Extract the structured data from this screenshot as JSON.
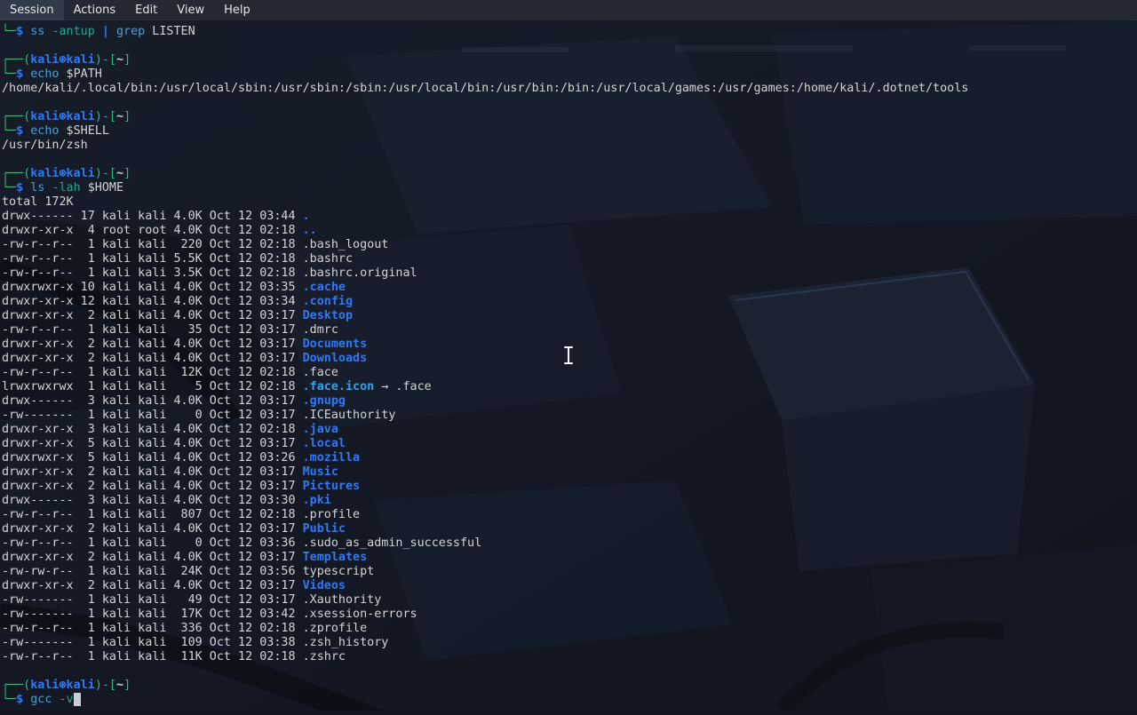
{
  "menubar": {
    "items": [
      {
        "label": "Session"
      },
      {
        "label": "Actions"
      },
      {
        "label": "Edit"
      },
      {
        "label": "View"
      },
      {
        "label": "Help"
      }
    ]
  },
  "prompt": {
    "user_host": "kali㉿kali",
    "cwd": "~"
  },
  "colors": {
    "menu_bg": "#232833",
    "menu_fg": "#e3e5e8",
    "term_bg": "#131824",
    "green": "#38b873",
    "blue": "#3179f2",
    "command": "#4f9fd0",
    "option": "#2aa595",
    "symlink": "#34a4e9",
    "fg": "#d2d4d6",
    "cursor": "#c9ced6"
  },
  "commands": {
    "history": [
      "ss -antup | grep LISTEN",
      "echo $PATH",
      "echo $SHELL",
      "ls -lah $HOME"
    ],
    "current_input": "gcc -v"
  },
  "outputs": {
    "path": "/home/kali/.local/bin:/usr/local/sbin:/usr/sbin:/sbin:/usr/local/bin:/usr/bin:/bin:/usr/local/games:/usr/games:/home/kali/.dotnet/tools",
    "shell": "/usr/bin/zsh",
    "ls_total": "total 172K"
  },
  "terminal": {
    "lines": [
      [
        [
          "g",
          "└─"
        ],
        [
          "b",
          "$"
        ],
        [
          "w",
          " "
        ],
        [
          "c",
          "ss"
        ],
        [
          "w",
          " "
        ],
        [
          "o",
          "-antup"
        ],
        [
          "w",
          " "
        ],
        [
          "b",
          "|"
        ],
        [
          "w",
          " "
        ],
        [
          "c",
          "grep"
        ],
        [
          "w",
          " LISTEN"
        ]
      ],
      [],
      [
        [
          "g",
          "┌──("
        ],
        [
          "b",
          "kali⊛kali"
        ],
        [
          "g",
          ")-["
        ],
        [
          "wb",
          "~"
        ],
        [
          "g",
          "]"
        ]
      ],
      [
        [
          "g",
          "└─"
        ],
        [
          "b",
          "$"
        ],
        [
          "w",
          " "
        ],
        [
          "c",
          "echo"
        ],
        [
          "w",
          " $PATH"
        ]
      ],
      [
        [
          "w",
          "/home/kali/.local/bin:/usr/local/sbin:/usr/sbin:/sbin:/usr/local/bin:/usr/bin:/bin:/usr/local/games:/usr/games:/home/kali/.dotnet/tools"
        ]
      ],
      [],
      [
        [
          "g",
          "┌──("
        ],
        [
          "b",
          "kali⊛kali"
        ],
        [
          "g",
          ")-["
        ],
        [
          "wb",
          "~"
        ],
        [
          "g",
          "]"
        ]
      ],
      [
        [
          "g",
          "└─"
        ],
        [
          "b",
          "$"
        ],
        [
          "w",
          " "
        ],
        [
          "c",
          "echo"
        ],
        [
          "w",
          " $SHELL"
        ]
      ],
      [
        [
          "w",
          "/usr/bin/zsh"
        ]
      ],
      [],
      [
        [
          "g",
          "┌──("
        ],
        [
          "b",
          "kali⊛kali"
        ],
        [
          "g",
          ")-["
        ],
        [
          "wb",
          "~"
        ],
        [
          "g",
          "]"
        ]
      ],
      [
        [
          "g",
          "└─"
        ],
        [
          "b",
          "$"
        ],
        [
          "w",
          " "
        ],
        [
          "c",
          "ls"
        ],
        [
          "w",
          " "
        ],
        [
          "o",
          "-lah"
        ],
        [
          "w",
          " $HOME"
        ]
      ],
      [
        [
          "w",
          "total 172K"
        ]
      ],
      [
        [
          "w",
          "drwx------ 17 kali kali 4.0K Oct 12 03:44 "
        ],
        [
          "d",
          "."
        ]
      ],
      [
        [
          "w",
          "drwxr-xr-x  4 root root 4.0K Oct 12 02:18 "
        ],
        [
          "d",
          ".."
        ]
      ],
      [
        [
          "w",
          "-rw-r--r--  1 kali kali  220 Oct 12 02:18 .bash_logout"
        ]
      ],
      [
        [
          "w",
          "-rw-r--r--  1 kali kali 5.5K Oct 12 02:18 .bashrc"
        ]
      ],
      [
        [
          "w",
          "-rw-r--r--  1 kali kali 3.5K Oct 12 02:18 .bashrc.original"
        ]
      ],
      [
        [
          "w",
          "drwxrwxr-x 10 kali kali 4.0K Oct 12 03:35 "
        ],
        [
          "d",
          ".cache"
        ]
      ],
      [
        [
          "w",
          "drwxr-xr-x 12 kali kali 4.0K Oct 12 03:34 "
        ],
        [
          "d",
          ".config"
        ]
      ],
      [
        [
          "w",
          "drwxr-xr-x  2 kali kali 4.0K Oct 12 03:17 "
        ],
        [
          "d",
          "Desktop"
        ]
      ],
      [
        [
          "w",
          "-rw-r--r--  1 kali kali   35 Oct 12 03:17 .dmrc"
        ]
      ],
      [
        [
          "w",
          "drwxr-xr-x  2 kali kali 4.0K Oct 12 03:17 "
        ],
        [
          "d",
          "Documents"
        ]
      ],
      [
        [
          "w",
          "drwxr-xr-x  2 kali kali 4.0K Oct 12 03:17 "
        ],
        [
          "d",
          "Downloads"
        ]
      ],
      [
        [
          "w",
          "-rw-r--r--  1 kali kali  12K Oct 12 02:18 .face"
        ]
      ],
      [
        [
          "w",
          "lrwxrwxrwx  1 kali kali    5 Oct 12 02:18 "
        ],
        [
          "s",
          ".face.icon"
        ],
        [
          "w",
          " → .face"
        ]
      ],
      [
        [
          "w",
          "drwx------  3 kali kali 4.0K Oct 12 03:17 "
        ],
        [
          "d",
          ".gnupg"
        ]
      ],
      [
        [
          "w",
          "-rw-------  1 kali kali    0 Oct 12 03:17 .ICEauthority"
        ]
      ],
      [
        [
          "w",
          "drwxr-xr-x  3 kali kali 4.0K Oct 12 02:18 "
        ],
        [
          "d",
          ".java"
        ]
      ],
      [
        [
          "w",
          "drwxr-xr-x  5 kali kali 4.0K Oct 12 03:17 "
        ],
        [
          "d",
          ".local"
        ]
      ],
      [
        [
          "w",
          "drwxrwxr-x  5 kali kali 4.0K Oct 12 03:26 "
        ],
        [
          "d",
          ".mozilla"
        ]
      ],
      [
        [
          "w",
          "drwxr-xr-x  2 kali kali 4.0K Oct 12 03:17 "
        ],
        [
          "d",
          "Music"
        ]
      ],
      [
        [
          "w",
          "drwxr-xr-x  2 kali kali 4.0K Oct 12 03:17 "
        ],
        [
          "d",
          "Pictures"
        ]
      ],
      [
        [
          "w",
          "drwx------  3 kali kali 4.0K Oct 12 03:30 "
        ],
        [
          "d",
          ".pki"
        ]
      ],
      [
        [
          "w",
          "-rw-r--r--  1 kali kali  807 Oct 12 02:18 .profile"
        ]
      ],
      [
        [
          "w",
          "drwxr-xr-x  2 kali kali 4.0K Oct 12 03:17 "
        ],
        [
          "d",
          "Public"
        ]
      ],
      [
        [
          "w",
          "-rw-r--r--  1 kali kali    0 Oct 12 03:36 .sudo_as_admin_successful"
        ]
      ],
      [
        [
          "w",
          "drwxr-xr-x  2 kali kali 4.0K Oct 12 03:17 "
        ],
        [
          "d",
          "Templates"
        ]
      ],
      [
        [
          "w",
          "-rw-rw-r--  1 kali kali  24K Oct 12 03:56 typescript"
        ]
      ],
      [
        [
          "w",
          "drwxr-xr-x  2 kali kali 4.0K Oct 12 03:17 "
        ],
        [
          "d",
          "Videos"
        ]
      ],
      [
        [
          "w",
          "-rw-------  1 kali kali   49 Oct 12 03:17 .Xauthority"
        ]
      ],
      [
        [
          "w",
          "-rw-------  1 kali kali  17K Oct 12 03:42 .xsession-errors"
        ]
      ],
      [
        [
          "w",
          "-rw-r--r--  1 kali kali  336 Oct 12 02:18 .zprofile"
        ]
      ],
      [
        [
          "w",
          "-rw-------  1 kali kali  109 Oct 12 03:38 .zsh_history"
        ]
      ],
      [
        [
          "w",
          "-rw-r--r--  1 kali kali  11K Oct 12 02:18 .zshrc"
        ]
      ],
      [],
      [
        [
          "g",
          "┌──("
        ],
        [
          "b",
          "kali⊛kali"
        ],
        [
          "g",
          ")-["
        ],
        [
          "wb",
          "~"
        ],
        [
          "g",
          "]"
        ]
      ],
      [
        [
          "g",
          "└─"
        ],
        [
          "b",
          "$"
        ],
        [
          "w",
          " "
        ],
        [
          "c",
          "gcc"
        ],
        [
          "w",
          " "
        ],
        [
          "o",
          "-v"
        ],
        [
          "cur",
          " "
        ]
      ]
    ]
  }
}
